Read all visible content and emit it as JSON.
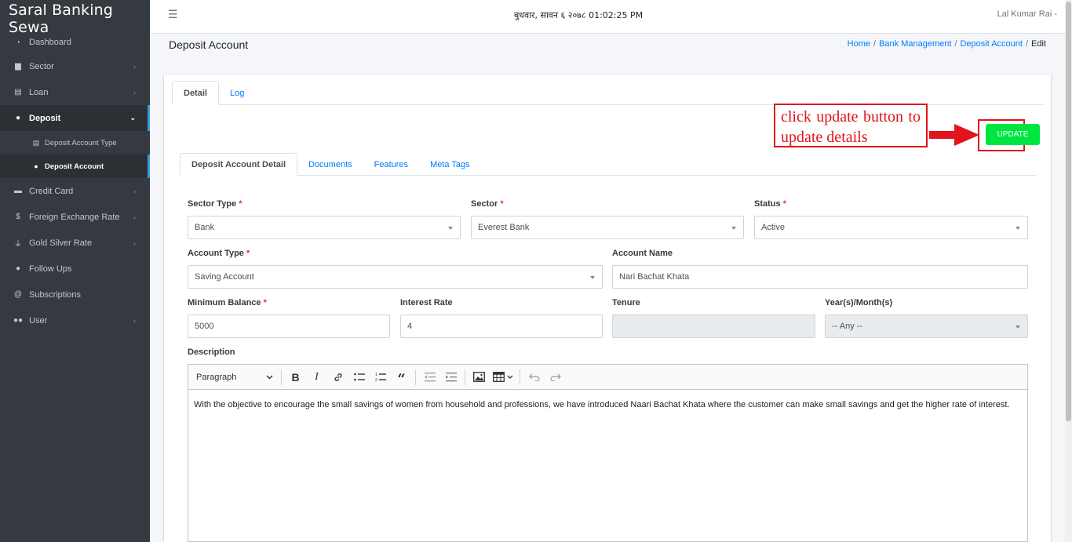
{
  "brand": "Saral Banking Sewa",
  "sidebar": {
    "items": [
      {
        "label": "Dashboard",
        "icon": "dashboard-icon"
      },
      {
        "label": "Sector",
        "icon": "sector-icon"
      },
      {
        "label": "Loan",
        "icon": "loan-icon"
      },
      {
        "label": "Deposit",
        "icon": "piggy-bank-icon"
      },
      {
        "label": "Deposit Account Type",
        "icon": "card-icon"
      },
      {
        "label": "Deposit Account",
        "icon": "user-circle-icon"
      },
      {
        "label": "Credit Card",
        "icon": "credit-card-icon"
      },
      {
        "label": "Foreign Exchange Rate",
        "icon": "dollar-icon"
      },
      {
        "label": "Gold Silver Rate",
        "icon": "hand-coin-icon"
      },
      {
        "label": "Follow Ups",
        "icon": "user-plus-icon"
      },
      {
        "label": "Subscriptions",
        "icon": "at-icon"
      },
      {
        "label": "User",
        "icon": "users-icon"
      }
    ]
  },
  "topbar": {
    "datetime": "बुधवार, सावन ६ २०७८ 01:02:25 PM",
    "user": "Lal Kumar Rai"
  },
  "header": {
    "title": "Deposit Account",
    "breadcrumb": [
      "Home",
      "Bank Management",
      "Deposit Account",
      "Edit"
    ]
  },
  "tabs_top": [
    "Detail",
    "Log"
  ],
  "annotation": "click update button to update details",
  "update_label": "UPDATE",
  "tabs_form": [
    "Deposit Account Detail",
    "Documents",
    "Features",
    "Meta Tags"
  ],
  "form": {
    "sector_type": {
      "label": "Sector Type",
      "value": "Bank"
    },
    "sector": {
      "label": "Sector",
      "value": "Everest Bank"
    },
    "status": {
      "label": "Status",
      "value": "Active"
    },
    "account_type": {
      "label": "Account Type",
      "value": "Saving Account"
    },
    "account_name": {
      "label": "Account Name",
      "value": "Nari Bachat Khata"
    },
    "minimum_balance": {
      "label": "Minimum Balance",
      "value": "5000"
    },
    "interest_rate": {
      "label": "Interest Rate",
      "value": "4"
    },
    "tenure": {
      "label": "Tenure",
      "value": ""
    },
    "period": {
      "label": "Year(s)/Month(s)",
      "value": "-- Any --"
    },
    "description": {
      "label": "Description"
    }
  },
  "editor": {
    "paragraph_label": "Paragraph",
    "content": "With the objective to encourage the small savings of women from household and professions, we have introduced Naari Bachat Khata where the customer can make small savings and get the higher rate of interest."
  },
  "colors": {
    "sidebar_bg": "#343a40",
    "link": "#007bff",
    "update_button": "#00e640",
    "annotation": "#e0141c",
    "required": "#dc3545"
  }
}
